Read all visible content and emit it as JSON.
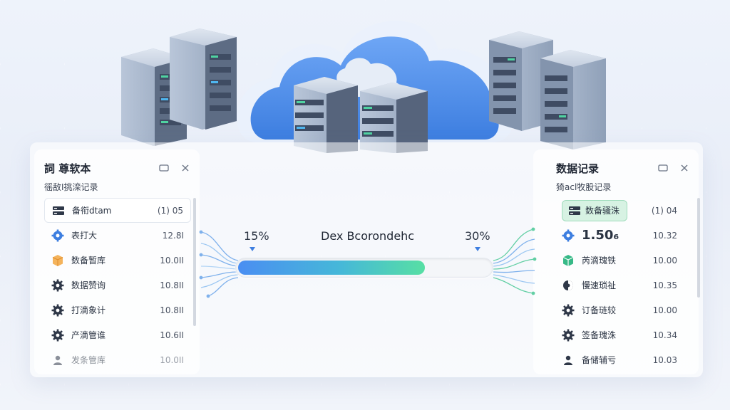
{
  "left_panel": {
    "title": "詞 尊软本",
    "subtitle": "徭敌I挑滦记录",
    "items": [
      {
        "label": "备衔dtam",
        "value": "(1) 05",
        "icon": "server-icon"
      },
      {
        "label": "表打大",
        "value": "12.8I",
        "icon": "gear-icon"
      },
      {
        "label": "数备暂库",
        "value": "10.0II",
        "icon": "box-icon"
      },
      {
        "label": "数据赞询",
        "value": "10.8II",
        "icon": "gear-icon"
      },
      {
        "label": "打滴象计",
        "value": "10.8II",
        "icon": "gear-icon"
      },
      {
        "label": "产滴管谁",
        "value": "10.6II",
        "icon": "gear-icon"
      },
      {
        "label": "发条管库",
        "value": "10.0II",
        "icon": "user-icon"
      }
    ]
  },
  "right_panel": {
    "title": "数据记录",
    "subtitle": "猗acl牧股记录",
    "items": [
      {
        "label": "数备骚洙",
        "value": "(1) 04",
        "icon": "server-icon"
      },
      {
        "label": "1.50₆",
        "value": "10.32",
        "icon": "gear-icon"
      },
      {
        "label": "芮滴瑰铁",
        "value": "10.00",
        "icon": "cube-icon"
      },
      {
        "label": "慢速琐祉",
        "value": "10.35",
        "icon": "shield-icon"
      },
      {
        "label": "订备琏较",
        "value": "10.00",
        "icon": "gear-icon"
      },
      {
        "label": "签备瑰洙",
        "value": "10.34",
        "icon": "gear-icon"
      },
      {
        "label": "备储辅亏",
        "value": "10.03",
        "icon": "user-icon"
      }
    ]
  },
  "progress": {
    "title": "Dex Bcorondehc",
    "left_pct": "15%",
    "right_pct": "30%",
    "fill_fraction": 0.74
  },
  "colors": {
    "accent": "#3d7ee0",
    "progress_start": "#4a8ef2",
    "progress_end": "#57dfa4",
    "highlight_green": "#d7f2e3"
  }
}
